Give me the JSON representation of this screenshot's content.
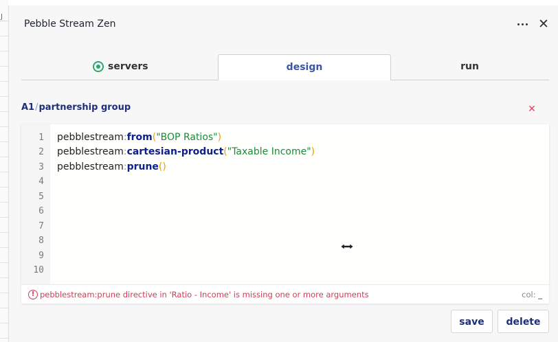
{
  "background_sheet": {
    "column_header": "J"
  },
  "dialog": {
    "title": "Pebble Stream Zen",
    "more_icon": "more-horizontal-icon",
    "close_icon": "close-icon"
  },
  "tabs": [
    {
      "label": "servers",
      "icon": "radio-selected-icon",
      "active": false
    },
    {
      "label": "design",
      "active": true
    },
    {
      "label": "run",
      "active": false
    }
  ],
  "breadcrumb": {
    "cell": "A1",
    "separator": "/",
    "group": "partnership group"
  },
  "clear_icon": "x-icon",
  "editor": {
    "line_numbers": [
      "1",
      "2",
      "3",
      "4",
      "5",
      "6",
      "7",
      "8",
      "9",
      "10"
    ],
    "lines": [
      {
        "ns": "pebblestream",
        "colon": ":",
        "fn": "from",
        "open": "(",
        "arg": "\"BOP Ratios\"",
        "close": ")"
      },
      {
        "ns": "pebblestream",
        "colon": ":",
        "fn": "cartesian-product",
        "open": "(",
        "arg": "\"Taxable Income\"",
        "close": ")"
      },
      {
        "ns": "pebblestream",
        "colon": ":",
        "fn": "prune",
        "open": "(",
        "arg": "",
        "close": ")"
      }
    ]
  },
  "status": {
    "error_icon": "alert-circle-icon",
    "error_message": "pebblestream:prune directive in 'Ratio - Income' is missing one or more arguments",
    "col_label": "col:",
    "col_value": "_"
  },
  "actions": {
    "save_label": "save",
    "delete_label": "delete"
  },
  "colors": {
    "accent": "#1c2f7a",
    "active_tab": "#3a55a8",
    "function": "#0d1f8a",
    "string": "#1b8a38",
    "paren": "#e6a000",
    "error": "#d03a52",
    "radio": "#2aa870"
  }
}
